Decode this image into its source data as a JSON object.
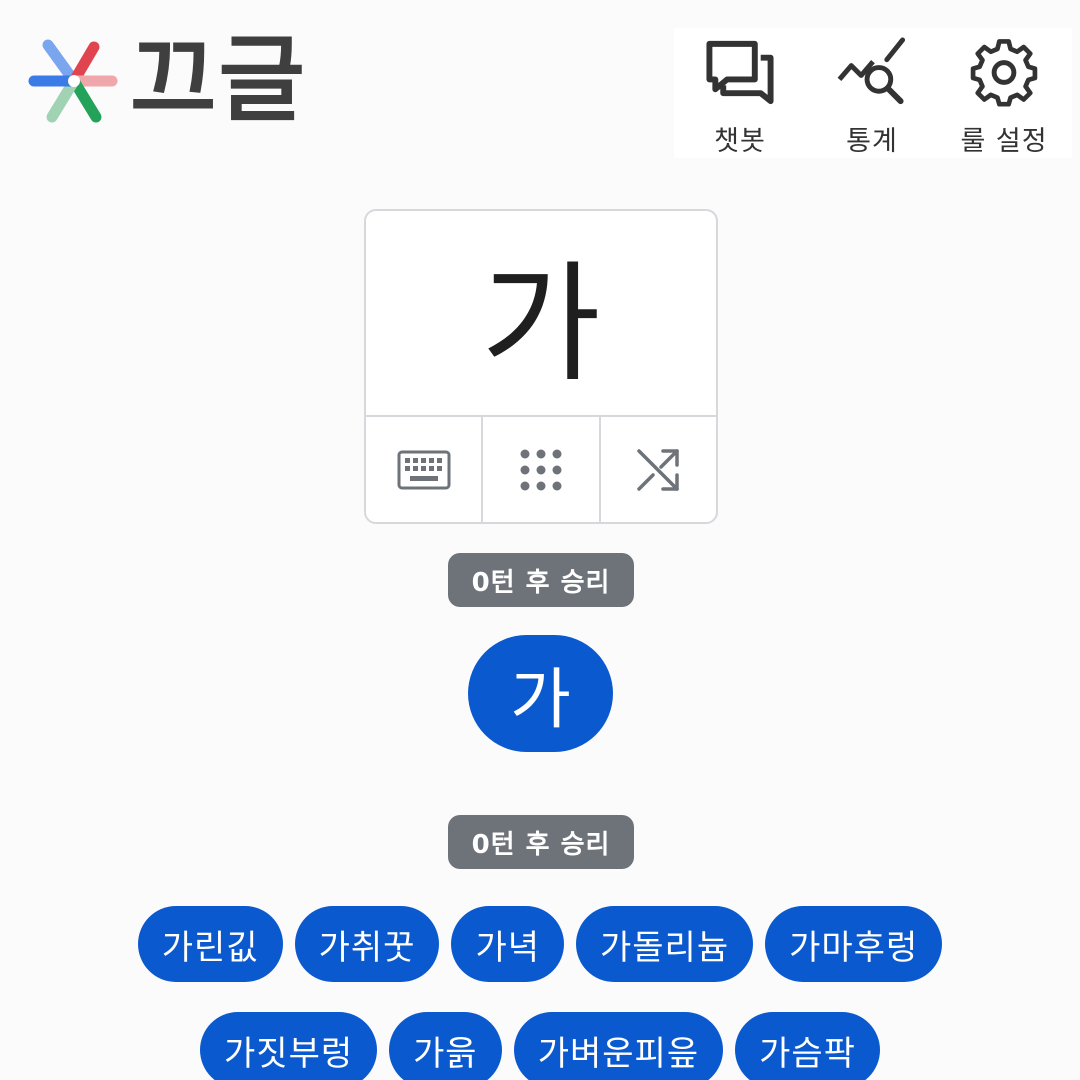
{
  "header": {
    "title": "끄글",
    "logo_icon": "asterisk-logo-icon",
    "nav": [
      {
        "label": "챗봇",
        "icon": "chat-bubbles-icon"
      },
      {
        "label": "통계",
        "icon": "stats-search-icon"
      },
      {
        "label": "룰 설정",
        "icon": "gear-icon"
      }
    ]
  },
  "card": {
    "character": "가",
    "tools": [
      {
        "icon": "keyboard-icon"
      },
      {
        "icon": "dial-pad-icon"
      },
      {
        "icon": "shuffle-icon"
      }
    ]
  },
  "result_badge_top": "0턴 후 승리",
  "result_word": "가",
  "result_badge_bottom": "0턴 후 승리",
  "words": [
    "가린깂",
    "가취꿋",
    "가녁",
    "가돌리늄",
    "가마후렁",
    "가짓부렁",
    "가읅",
    "가벼운피읖",
    "가슴팍"
  ],
  "colors": {
    "accent": "#0b59cf",
    "badge": "#6e737a",
    "logo_blue": "#3b7be8",
    "logo_red": "#e0454f",
    "logo_green": "#23a35a"
  }
}
